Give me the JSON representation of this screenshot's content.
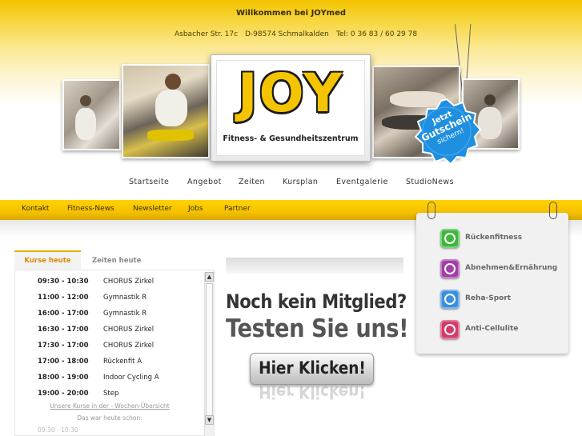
{
  "header": {
    "welcome": "Willkommen bei JOYmed",
    "address_street": "Asbacher Str. 17c",
    "address_city": "D-98574 Schmalkalden",
    "phone": "Tel: 0 36 83 / 60 29 78",
    "logo_text": "JOY",
    "logo_subtitle": "Fitness- & Gesundheitszentrum",
    "badge": {
      "line1": "Jetzt",
      "line2": "Gutschein",
      "line3": "sichern!"
    },
    "colors": {
      "brand_yellow": "#f5c400",
      "badge_blue": "#1f8fe0"
    }
  },
  "top_nav": [
    "Startseite",
    "Angebot",
    "Zeiten",
    "Kursplan",
    "Eventgalerie",
    "StudioNews"
  ],
  "secondary_nav": [
    "Kontakt",
    "Fitness-News",
    "Newsletter",
    "Jobs",
    "Partner"
  ],
  "services": [
    {
      "label": "Rückenfitness",
      "icon": "back-fitness-icon",
      "color": "#3db83d"
    },
    {
      "label": "Abnehmen&Ernährung",
      "icon": "weight-loss-icon",
      "color": "#a23ea8"
    },
    {
      "label": "Reha-Sport",
      "icon": "rehab-icon",
      "color": "#3a8fe0"
    },
    {
      "label": "Anti-Cellulite",
      "icon": "anti-cellulite-icon",
      "color": "#d43a6a"
    }
  ],
  "schedule": {
    "tab_active": "Kurse heute",
    "tab_inactive": "Zeiten heute",
    "rows": [
      {
        "time": "09:30 - 10:30",
        "course": "CHORUS Zirkel"
      },
      {
        "time": "11:00 - 12:00",
        "course": "Gymnastik R"
      },
      {
        "time": "16:00 - 17:00",
        "course": "Gymnastik R"
      },
      {
        "time": "16:30 - 17:00",
        "course": "CHORUS Zirkel"
      },
      {
        "time": "17:30 - 17:00",
        "course": "CHORUS Zirkel"
      },
      {
        "time": "17:00 - 18:00",
        "course": "Rückenfit A"
      },
      {
        "time": "18:00 - 19:00",
        "course": "Indoor Cycling A"
      },
      {
        "time": "19:00 - 20:00",
        "course": "Step"
      }
    ],
    "week_link": "Unsere Kurse in der - Wochen-Übersicht",
    "note": "Das war heute schon:",
    "cut_off": "09:30 - 10:30"
  },
  "promo": {
    "line1": "Noch kein Mitglied?",
    "line2": "Testen Sie uns!",
    "cta": "Hier Klicken!"
  }
}
